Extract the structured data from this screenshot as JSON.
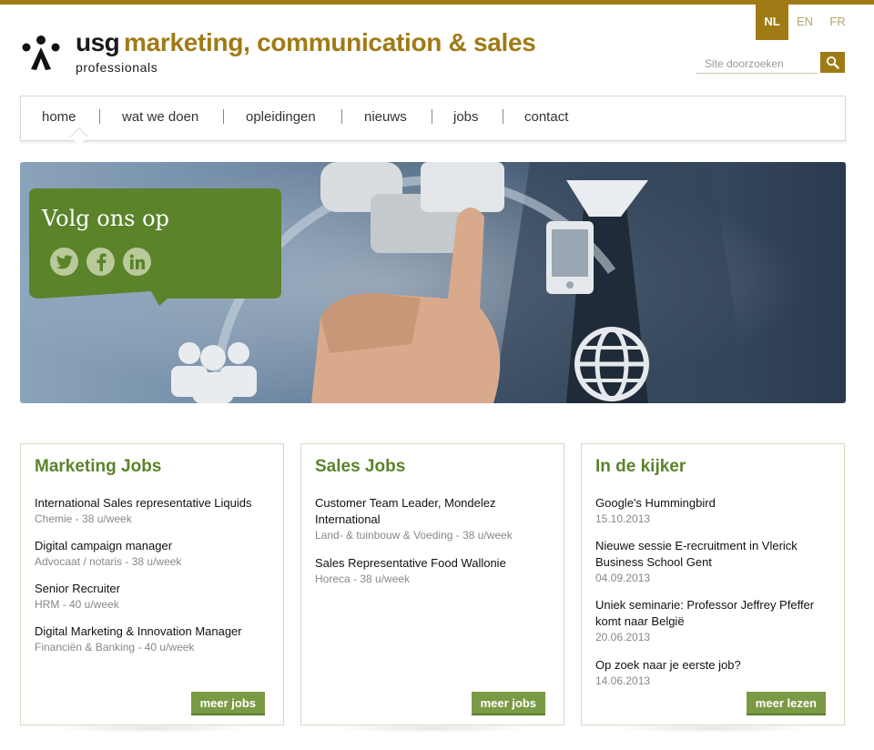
{
  "header": {
    "logo_usg": "usg",
    "logo_tagline": "marketing, communication & sales",
    "logo_sub": "professionals",
    "languages": [
      {
        "code": "NL",
        "active": true
      },
      {
        "code": "EN",
        "active": false
      },
      {
        "code": "FR",
        "active": false
      }
    ],
    "search": {
      "placeholder": "Site doorzoeken",
      "icon": "search-icon"
    }
  },
  "nav": {
    "items": [
      "home",
      "wat we doen",
      "opleidingen",
      "nieuws",
      "jobs",
      "contact"
    ],
    "active": "home"
  },
  "hero": {
    "follow_title": "Volg ons op",
    "social": [
      "twitter-icon",
      "facebook-icon",
      "linkedin-icon"
    ]
  },
  "marketing": {
    "title": "Marketing Jobs",
    "items": [
      {
        "title": "International Sales representative Liquids",
        "meta": "Chemie - 38 u/week"
      },
      {
        "title": "Digital campaign manager",
        "meta": "Advocaat / notaris - 38 u/week"
      },
      {
        "title": "Senior Recruiter",
        "meta": "HRM - 40 u/week"
      },
      {
        "title": "Digital Marketing & Innovation Manager",
        "meta": "Financiën & Banking - 40 u/week"
      }
    ],
    "button": "meer jobs"
  },
  "sales": {
    "title": "Sales Jobs",
    "items": [
      {
        "title": "Customer Team Leader, Mondelez International",
        "meta": "Land- & tuinbouw & Voeding - 38 u/week"
      },
      {
        "title": "Sales Representative Food Wallonie",
        "meta": "Horeca - 38 u/week"
      }
    ],
    "button": "meer jobs"
  },
  "spotlight": {
    "title": "In de kijker",
    "items": [
      {
        "title": "Google's Hummingbird",
        "meta": "15.10.2013"
      },
      {
        "title": "Nieuwe sessie E-recruitment in Vlerick Business School Gent",
        "meta": "04.09.2013"
      },
      {
        "title": "Uniek seminarie: Professor Jeffrey Pfeffer komt naar België",
        "meta": "20.06.2013"
      },
      {
        "title": "Op zoek naar je eerste job?",
        "meta": "14.06.2013"
      }
    ],
    "button": "meer lezen"
  },
  "colors": {
    "brand_gold": "#a07a14",
    "green": "#5a832a",
    "button_green": "#7a9a45"
  }
}
